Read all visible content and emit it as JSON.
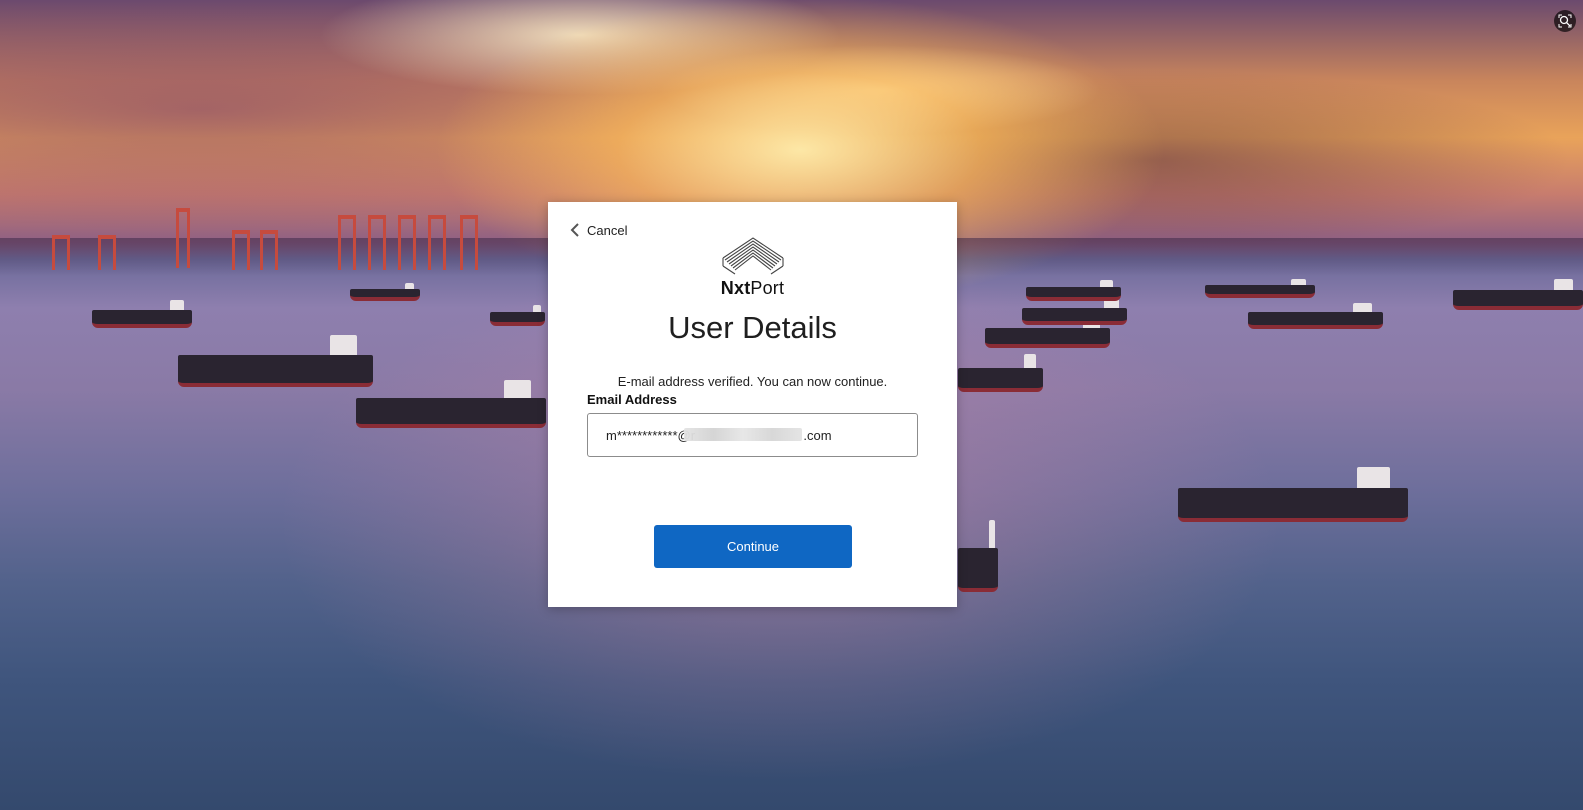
{
  "page": {
    "background_image": "harbor-sunset-ships"
  },
  "card": {
    "cancel_label": "Cancel",
    "logo": {
      "prefix": "Nxt",
      "suffix": "Port",
      "icon": "nxtport-logo-icon"
    },
    "title": "User Details",
    "verified_message": "E-mail address verified. You can now continue.",
    "email_label": "Email Address",
    "email_value": "m************@r                              .com",
    "continue_label": "Continue"
  },
  "colors": {
    "primary_button": "#0f67c3",
    "card_background": "#ffffff"
  },
  "icons": {
    "back": "chevron-left-icon",
    "fullscreen": "fullscreen-icon"
  }
}
